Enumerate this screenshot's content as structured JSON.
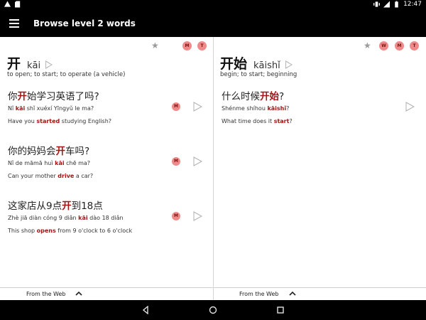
{
  "status_bar": {
    "time": "12:47"
  },
  "app_bar": {
    "title": "Browse level 2 words"
  },
  "left_card": {
    "hanzi": "开",
    "pinyin": "kāi",
    "definition": "to open; to start; to operate (a vehicle)",
    "badges": [
      "M",
      "T"
    ],
    "examples": [
      {
        "hanzi": [
          "你",
          "开",
          "始学习英语了吗?"
        ],
        "pinyin": [
          "Nǐ ",
          "kāi",
          " shǐ xuéxí Yīngyǔ le ma?"
        ],
        "english": [
          "Have you ",
          "started",
          " studying English?"
        ],
        "badge": "M"
      },
      {
        "hanzi": [
          "你的妈妈会",
          "开",
          "车吗?"
        ],
        "pinyin": [
          "Nǐ de māmā huì ",
          "kāi",
          " chē ma?"
        ],
        "english": [
          "Can your mother ",
          "drive",
          " a car?"
        ],
        "badge": "M"
      },
      {
        "hanzi": [
          "这家店从9点",
          "开",
          "到18点"
        ],
        "pinyin": [
          "Zhè jiā diàn cóng 9 diǎn ",
          "kāi",
          " dào 18 diǎn"
        ],
        "english": [
          "This shop ",
          "opens",
          " from 9 o'clock to 6 o'clock"
        ],
        "badge": "M"
      }
    ]
  },
  "right_card": {
    "hanzi": "开始",
    "pinyin": "kāishǐ",
    "definition": "begin; to start; beginning",
    "badges": [
      "W",
      "M",
      "T"
    ],
    "examples": [
      {
        "hanzi": [
          "什么时候",
          "开始",
          "?"
        ],
        "pinyin": [
          "Shénme shíhou ",
          "kāishǐ",
          "?"
        ],
        "english": [
          "What time does it ",
          "start",
          "?"
        ]
      }
    ]
  },
  "web_bar": {
    "label": "From the Web"
  },
  "colors": {
    "highlight": "#a31515",
    "badge": "#ef8a8a",
    "bars": "#000000"
  },
  "icons": [
    "notification-icon",
    "sd-card-icon",
    "vibrate-icon",
    "signal-icon",
    "battery-icon",
    "menu-icon",
    "star-icon",
    "play-icon",
    "chevron-up-icon",
    "back-icon",
    "home-icon",
    "recents-icon"
  ]
}
